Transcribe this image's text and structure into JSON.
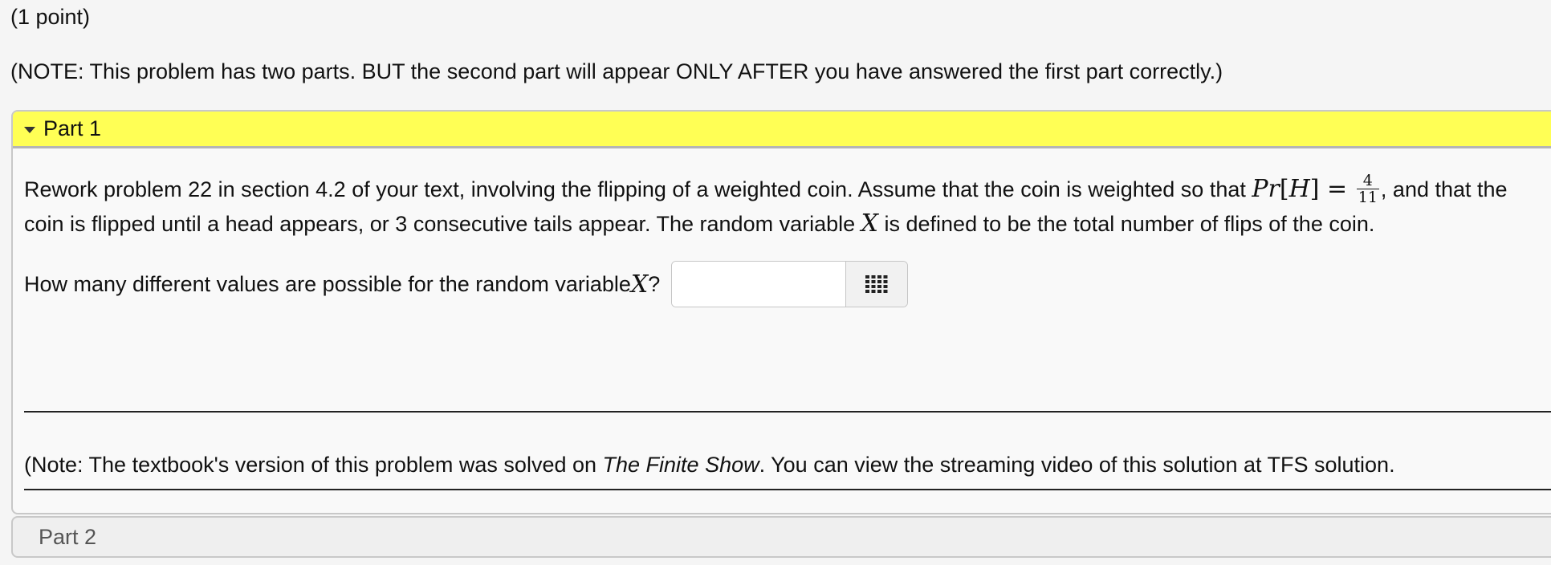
{
  "points": "(1 point)",
  "note_top": "(NOTE: This problem has two parts. BUT the second part will appear ONLY AFTER you have answered the first part correctly.)",
  "part1": {
    "title": "Part 1",
    "para": {
      "t1": "Rework problem 22 in section 4.2 of your text, involving the flipping of a weighted coin. Assume that the coin is weighted so that ",
      "m_pr": "Pr",
      "m_h_open": "[",
      "m_h": "H",
      "m_h_close": "]",
      "m_eq": " = ",
      "frac_num": "4",
      "frac_den": "11",
      "t2": ", and that the coin is flipped until a head appears, or 3 consecutive tails appear. The random variable ",
      "m_x": "X",
      "t3": " is defined to be the total number of flips of the coin."
    },
    "question": {
      "text": "How many different values are possible for the random variable ",
      "var": "X",
      "suffix": "?",
      "answer_value": "",
      "answer_placeholder": ""
    },
    "note_bottom": {
      "t1": "(Note: The textbook's version of this problem was solved on ",
      "show": "The Finite Show",
      "t2": ". You can view the streaming video of this solution at ",
      "link": "TFS solution",
      "t3": "."
    }
  },
  "part2": {
    "title": "Part 2"
  },
  "colors": {
    "part1_header_bg": "#ffff55",
    "page_bg": "#f5f5f5"
  },
  "icons": {
    "collapse": "triangle-down-icon",
    "keypad": "keypad-grid-icon"
  }
}
